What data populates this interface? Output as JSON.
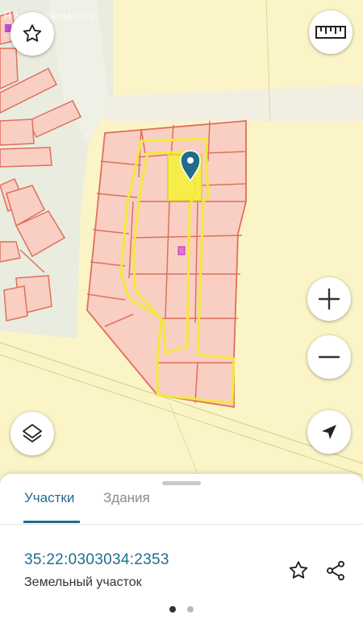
{
  "map": {
    "watermark": "Я Недвижимость"
  },
  "controls": {
    "favorite": "star-icon",
    "ruler": "ruler-icon",
    "zoom_in": "plus-icon",
    "zoom_out": "minus-icon",
    "layers": "layers-icon",
    "locate": "navigation-arrow-icon"
  },
  "sheet": {
    "tabs": [
      {
        "label": "Участки",
        "active": true
      },
      {
        "label": "Здания",
        "active": false
      }
    ],
    "parcel": {
      "cadastral_number": "35:22:0303034:2353",
      "type": "Земельный участок"
    },
    "pager": {
      "pages": 2,
      "current": 1
    }
  },
  "colors": {
    "accent": "#1f6d8c",
    "parcel_fill": "#f9cfc3",
    "parcel_stroke": "#e06f5e",
    "selected_fill": "#f5ee4a",
    "highlight_stroke": "#f3e83b",
    "map_bg": "#fbf4c6"
  }
}
